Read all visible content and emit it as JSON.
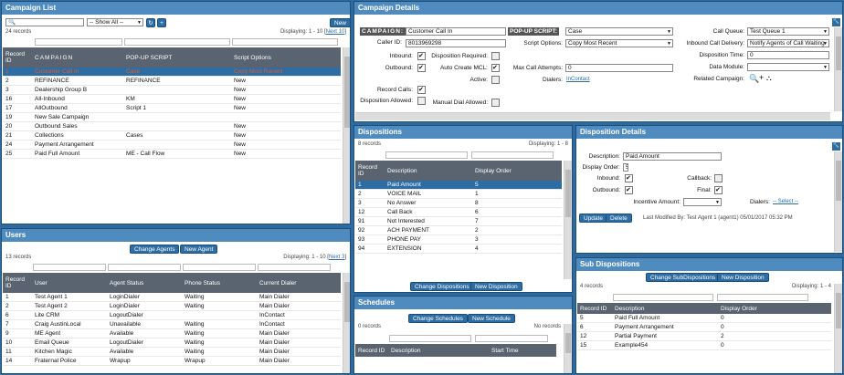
{
  "campaign_list": {
    "title": "Campaign List",
    "new_label": "New",
    "show_all": "-- Show All --",
    "count": "24 records",
    "displaying": "Displaying: 1 - 10 [",
    "next_link": "Next 10",
    "displaying_end": "]",
    "columns": [
      "Record ID",
      "CAMPAIGN",
      "POP-UP SCRIPT",
      "Script Options"
    ],
    "rows": [
      [
        "1",
        "Customer Call In",
        "Case",
        "Copy Most Recent"
      ],
      [
        "2",
        "REFINANCE",
        "REFINANCE",
        "New"
      ],
      [
        "3",
        "Dealership Group B",
        "",
        "New"
      ],
      [
        "16",
        "All-Inbound",
        "KM",
        "New"
      ],
      [
        "17",
        "AllOutbound",
        "Script 1",
        "New"
      ],
      [
        "19",
        "New Sale Campaign",
        "",
        ""
      ],
      [
        "20",
        "Outbound Sales",
        "",
        "New"
      ],
      [
        "21",
        "Collections",
        "Cases",
        "New"
      ],
      [
        "24",
        "Payment Arrangement",
        "",
        "New"
      ],
      [
        "25",
        "Paid Full Amount",
        "ME - Call Flow",
        "New"
      ]
    ]
  },
  "users": {
    "title": "Users",
    "change_agents": "Change Agents",
    "new_agent": "New Agent",
    "count": "13 records",
    "displaying": "Displaying: 1 - 10 [",
    "next_link": "Next 3",
    "displaying_end": "]",
    "columns": [
      "Record ID",
      "User",
      "Agent Status",
      "Phone Status",
      "Current Dialer"
    ],
    "rows": [
      [
        "1",
        "Test Agent 1",
        "LoginDialer",
        "Waiting",
        "Main Dialer"
      ],
      [
        "2",
        "Test Agent 2",
        "LoginDialer",
        "Waiting",
        "Main Dialer"
      ],
      [
        "6",
        "Lite CRM",
        "LogoutDialer",
        "",
        "InContact"
      ],
      [
        "7",
        "Craig AustinLocal",
        "Unavailable",
        "Waiting",
        "InContact"
      ],
      [
        "9",
        "ME Agent",
        "Available",
        "Waiting",
        "Main Dialer"
      ],
      [
        "10",
        "Email Queue",
        "LogoutDialer",
        "Waiting",
        "Main Dialer"
      ],
      [
        "11",
        "Kitchen Magic",
        "Available",
        "Waiting",
        "Main Dialer"
      ],
      [
        "14",
        "Fraternal Police",
        "Wrapup",
        "Wrapup",
        "Main Dialer"
      ]
    ]
  },
  "campaign_details": {
    "title": "Campaign Details",
    "campaign_label": "CAMPAIGN:",
    "campaign_value": "Customer Call In",
    "popup_label": "POP-UP SCRIPT:",
    "popup_value": "Case",
    "caller_id_label": "Caller ID:",
    "caller_id_value": "8013969298",
    "inbound_label": "Inbound:",
    "outbound_label": "Outbound:",
    "record_calls_label": "Record Calls:",
    "disp_allowed_label": "Disposition Allowed:",
    "disp_required_label": "Disposition Required:",
    "auto_create_label": "Auto Create MCL:",
    "active_label": "Active:",
    "manual_dial_label": "Manual Dial Allowed:",
    "script_options_label": "Script Options:",
    "script_options_value": "Copy Most Recent",
    "max_attempts_label": "Max Call Attempts:",
    "max_attempts_value": "0",
    "dialers_label": "Dialers:",
    "dialers_value": "InContact",
    "call_queue_label": "Call Queue:",
    "call_queue_value": "Test Queue 1",
    "inbound_delivery_label": "Inbound Call Delivery:",
    "inbound_delivery_value": "Notify Agents of Call Waiting",
    "disp_time_label": "Disposition Time:",
    "disp_time_value": "0",
    "data_module_label": "Data Module:",
    "data_module_value": "",
    "related_label": "Related Campaign:"
  },
  "dispositions": {
    "title": "Dispositions",
    "count": "8 records",
    "displaying": "Displaying: 1 - 8",
    "columns": [
      "Record ID",
      "Description",
      "Display Order"
    ],
    "rows": [
      [
        "1",
        "Paid Amount",
        "5"
      ],
      [
        "2",
        "VOICE MAIL",
        "1"
      ],
      [
        "3",
        "No Answer",
        "8"
      ],
      [
        "12",
        "Call Back",
        "6"
      ],
      [
        "91",
        "Not Interested",
        "7"
      ],
      [
        "92",
        "ACH PAYMENT",
        "2"
      ],
      [
        "93",
        "PHONE PAY",
        "3"
      ],
      [
        "94",
        "EXTENSION",
        "4"
      ]
    ],
    "change_label": "Change Dispositions",
    "new_label": "New Disposition"
  },
  "schedules": {
    "title": "Schedules",
    "change_label": "Change Schedules",
    "new_label": "New Schedule",
    "count": "0 records",
    "no_records": "No records",
    "columns": [
      "Record ID",
      "Description",
      "Start Time"
    ]
  },
  "disposition_details": {
    "title": "Disposition Details",
    "desc_label": "Description:",
    "desc_value": "Paid Amount",
    "order_label": "Display Order:",
    "order_value": "5",
    "inbound_label": "Inbound:",
    "outbound_label": "Outbound:",
    "callback_label": "Callback:",
    "final_label": "Final:",
    "incentive_label": "Incentive Amount:",
    "dialers_label": "Dialers:",
    "dialers_link": "-- Select --",
    "update_label": "Update",
    "delete_label": "Delete",
    "modified": "Last Modified By: Test Agent 1 (agent1) 05/01/2017 05:32 PM"
  },
  "sub_dispositions": {
    "title": "Sub Dispositions",
    "change_label": "Change SubDispositions",
    "new_label": "New Disposition",
    "count": "4 records",
    "displaying": "Displaying: 1 - 4",
    "columns": [
      "Record ID",
      "Description",
      "Display Order"
    ],
    "rows": [
      [
        "5",
        "Paid Full Amount",
        "0"
      ],
      [
        "6",
        "Payment Arrangement",
        "0"
      ],
      [
        "12",
        "Partial Payment",
        "2"
      ],
      [
        "15",
        "Example454",
        "0"
      ]
    ]
  }
}
